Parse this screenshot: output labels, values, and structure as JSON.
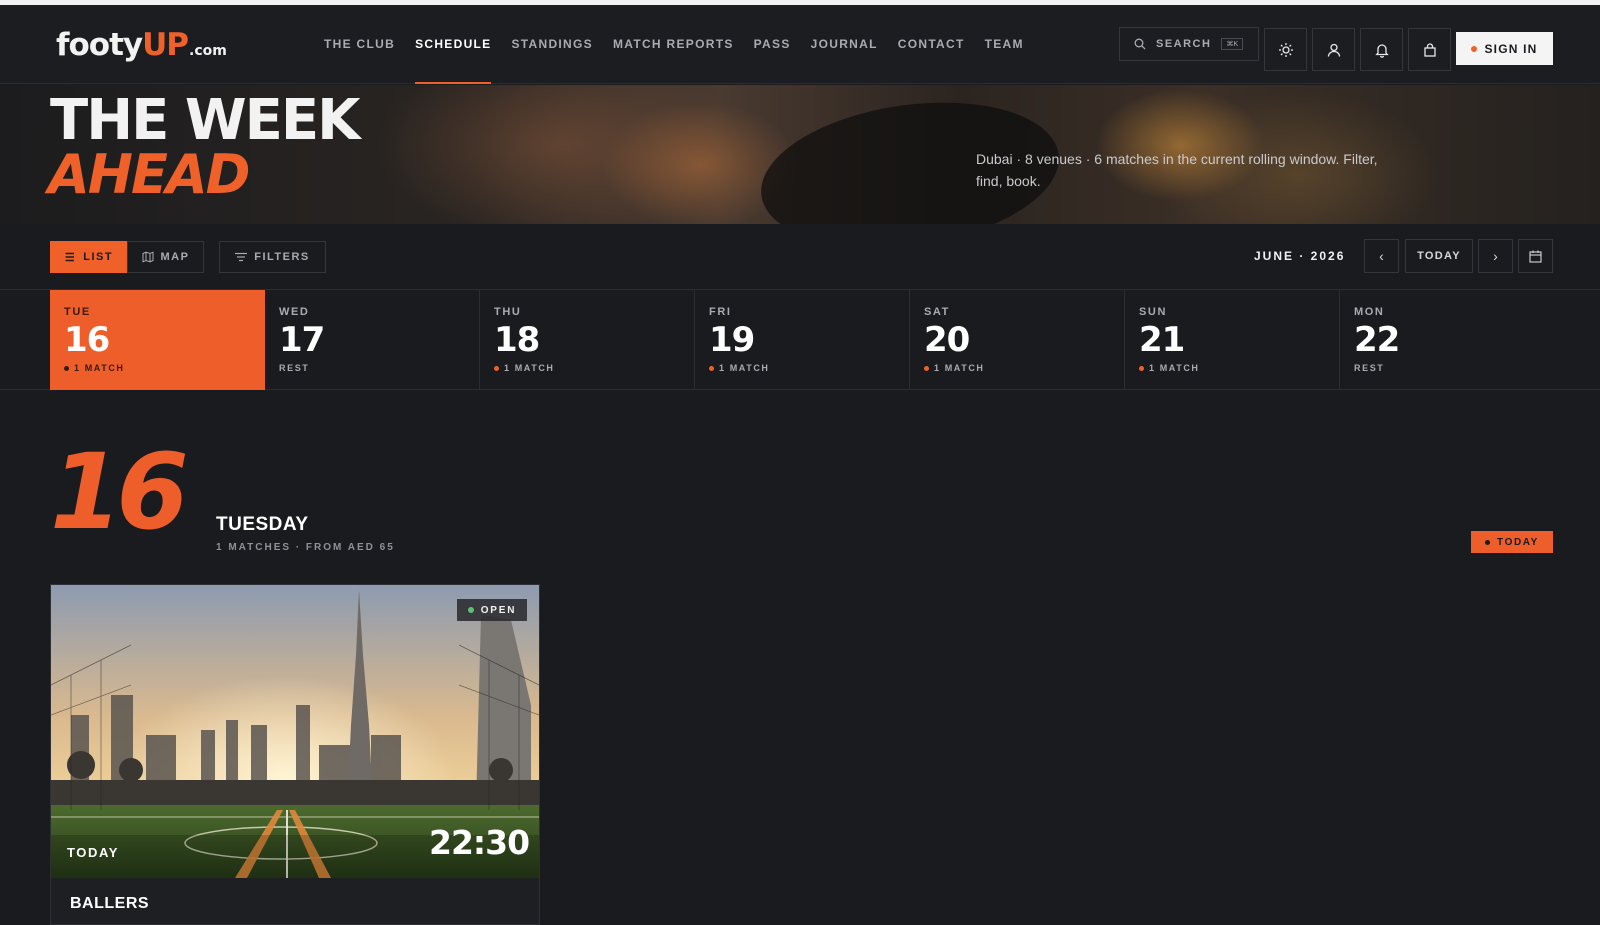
{
  "logo": {
    "part1": "footy",
    "part2": "UP",
    "part3": ".com"
  },
  "nav": {
    "items": [
      {
        "label": "THE CLUB",
        "active": false
      },
      {
        "label": "SCHEDULE",
        "active": true
      },
      {
        "label": "STANDINGS",
        "active": false
      },
      {
        "label": "MATCH REPORTS",
        "active": false
      },
      {
        "label": "PASS",
        "active": false
      },
      {
        "label": "JOURNAL",
        "active": false
      },
      {
        "label": "CONTACT",
        "active": false
      },
      {
        "label": "TEAM",
        "active": false
      }
    ]
  },
  "search": {
    "label": "SEARCH",
    "shortcut": "⌘K"
  },
  "header_icons": [
    "sun-icon",
    "user-icon",
    "bell-icon",
    "bag-icon"
  ],
  "signin": {
    "label": "SIGN IN"
  },
  "hero": {
    "title_line1": "THE WEEK",
    "title_line2": "AHEAD",
    "description": "Dubai · 8 venues · 6 matches in the current rolling window. Filter, find, book."
  },
  "toolbar": {
    "list_label": "LIST",
    "map_label": "MAP",
    "filters_label": "FILTERS",
    "month_label": "JUNE · 2026",
    "today_label": "TODAY"
  },
  "days": [
    {
      "dow": "TUE",
      "num": "16",
      "sub": "1 MATCH",
      "has_match": true,
      "selected": true
    },
    {
      "dow": "WED",
      "num": "17",
      "sub": "REST",
      "has_match": false,
      "selected": false
    },
    {
      "dow": "THU",
      "num": "18",
      "sub": "1 MATCH",
      "has_match": true,
      "selected": false
    },
    {
      "dow": "FRI",
      "num": "19",
      "sub": "1 MATCH",
      "has_match": true,
      "selected": false
    },
    {
      "dow": "SAT",
      "num": "20",
      "sub": "1 MATCH",
      "has_match": true,
      "selected": false
    },
    {
      "dow": "SUN",
      "num": "21",
      "sub": "1 MATCH",
      "has_match": true,
      "selected": false
    },
    {
      "dow": "MON",
      "num": "22",
      "sub": "REST",
      "has_match": false,
      "selected": false
    }
  ],
  "section": {
    "big_number": "16",
    "day_name": "TUESDAY",
    "meta": "1 MATCHES · FROM AED 65",
    "today_badge": "TODAY"
  },
  "card": {
    "status": "OPEN",
    "day_label": "TODAY",
    "time": "22:30",
    "title": "BALLERS"
  },
  "colors": {
    "accent": "#ee5e2a",
    "background": "#1a1b1f",
    "open_status": "#5fbf7a"
  }
}
